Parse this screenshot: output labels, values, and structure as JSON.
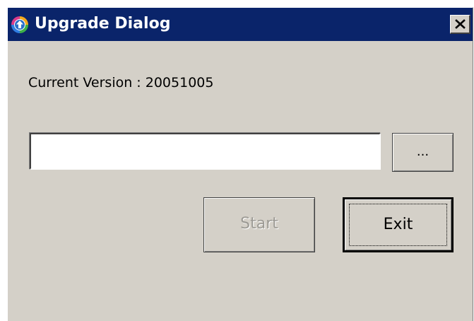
{
  "window": {
    "title": "Upgrade Dialog",
    "icon": "upgrade-arrow-icon",
    "close_icon": "close-icon"
  },
  "content": {
    "version_label": "Current Version : 20051005",
    "file_path": {
      "value": "",
      "placeholder": ""
    },
    "browse_button_label": "...",
    "start_button_label": "Start",
    "start_button_enabled": false,
    "exit_button_label": "Exit",
    "exit_button_focused": true
  },
  "colors": {
    "titlebar": "#0a246a",
    "dialog_face": "#d4d0c8",
    "disabled_text": "#9c9a94",
    "title_text": "#ffffff"
  }
}
